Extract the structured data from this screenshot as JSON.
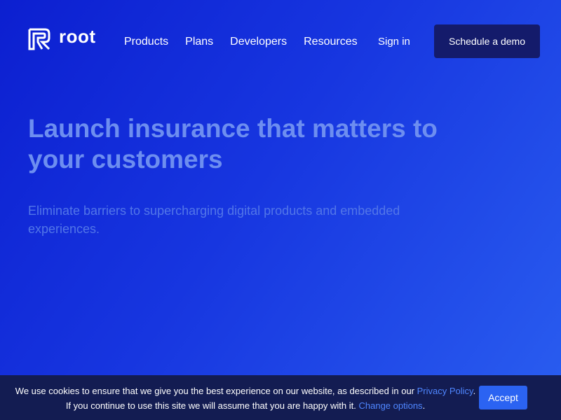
{
  "brand": {
    "name": "root",
    "logo_icon": "root-logo-icon"
  },
  "nav": {
    "links": [
      "Products",
      "Plans",
      "Developers",
      "Resources"
    ],
    "signin_label": "Sign in",
    "demo_label": "Schedule a demo"
  },
  "hero": {
    "title": "Launch insurance that matters to your customers",
    "subtitle": "Eliminate barriers to supercharging digital products and embedded experiences."
  },
  "cookie": {
    "line1_text": "We use cookies to ensure that we give you the best experience on our website, as described in our ",
    "privacy_link": "Privacy Policy",
    "line1_end": ".",
    "line2_text": "If you continue to use this site we will assume that you are happy with it. ",
    "change_link": "Change options",
    "line2_end": ".",
    "accept_label": "Accept"
  },
  "colors": {
    "background_start": "#0c1fd0",
    "background_end": "#2a5ef0",
    "demo_button": "#141b6b",
    "cookie_bar": "#131c52",
    "link": "#4f86ff",
    "accept_button": "#2b63f2",
    "hero_title": "#6d8ef0"
  }
}
